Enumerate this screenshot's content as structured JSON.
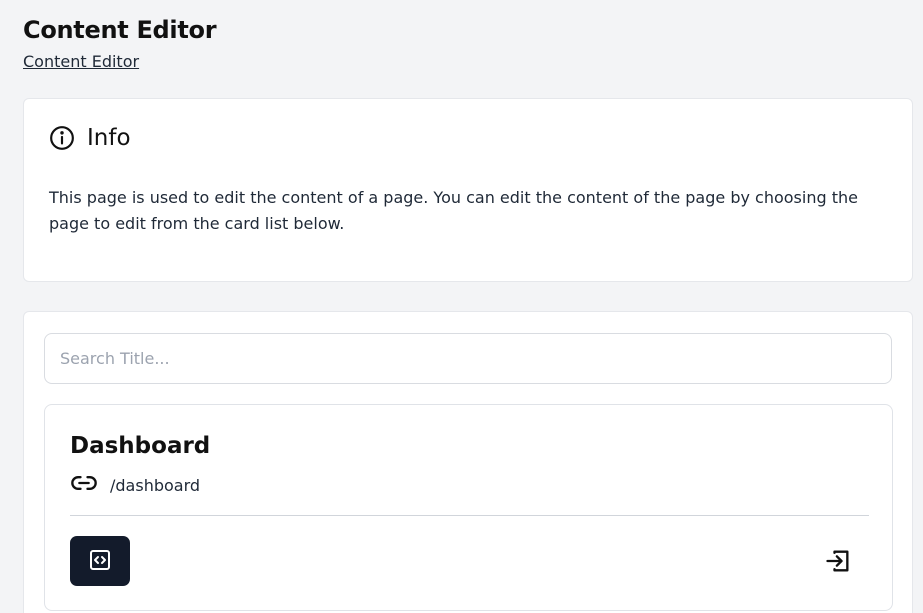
{
  "header": {
    "title": "Content Editor",
    "breadcrumb": "Content Editor"
  },
  "info": {
    "icon": "info-circle-icon",
    "title": "Info",
    "text": "This page is used to edit the content of a page. You can edit the content of the page by choosing the page to edit from the card list below."
  },
  "search": {
    "placeholder": "Search Title...",
    "value": ""
  },
  "pages": [
    {
      "title": "Dashboard",
      "path": "/dashboard",
      "link_icon": "link-icon",
      "edit_icon": "code-icon",
      "open_icon": "open-page-icon"
    }
  ],
  "colors": {
    "background": "#f3f4f6",
    "card": "#ffffff",
    "edit_button": "#131b2b"
  }
}
